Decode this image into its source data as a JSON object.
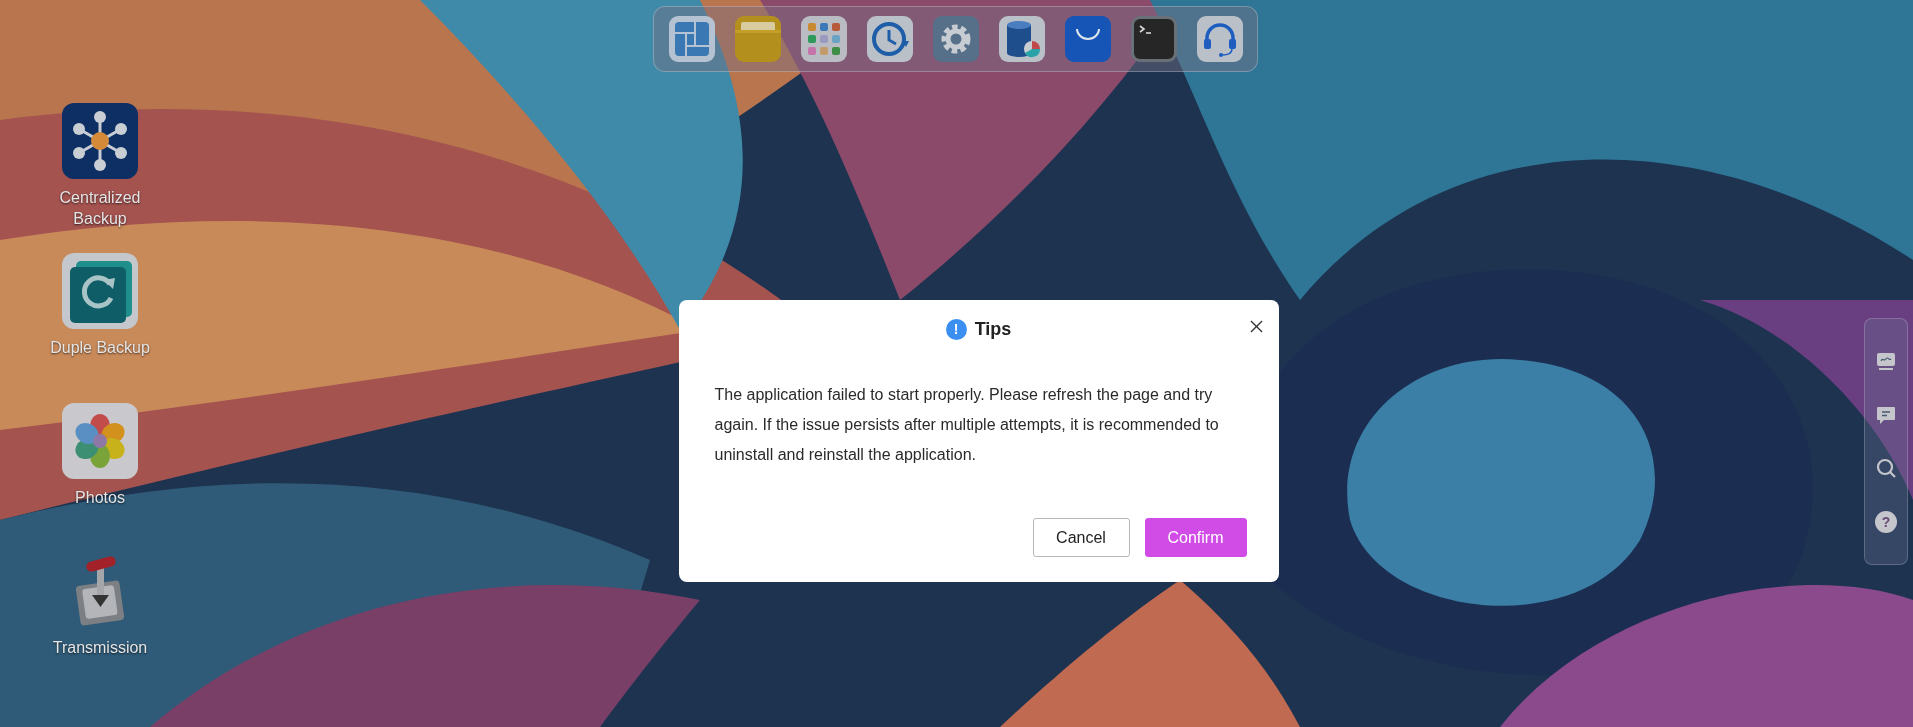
{
  "desktop_icons": [
    {
      "label": "Centralized Backup"
    },
    {
      "label": "Duple Backup"
    },
    {
      "label": "Photos"
    },
    {
      "label": "Transmission"
    }
  ],
  "sidebar": {
    "help_icon": "?"
  },
  "dialog": {
    "title_icon": "!",
    "title": "Tips",
    "message": "The application failed to start properly. Please refresh the page and try again. If the issue persists after multiple attempts, it is recommended to uninstall and reinstall the application.",
    "buttons": [
      {
        "label": "Cancel",
        "kind": "secondary"
      },
      {
        "label": "Confirm",
        "kind": "primary"
      }
    ]
  }
}
